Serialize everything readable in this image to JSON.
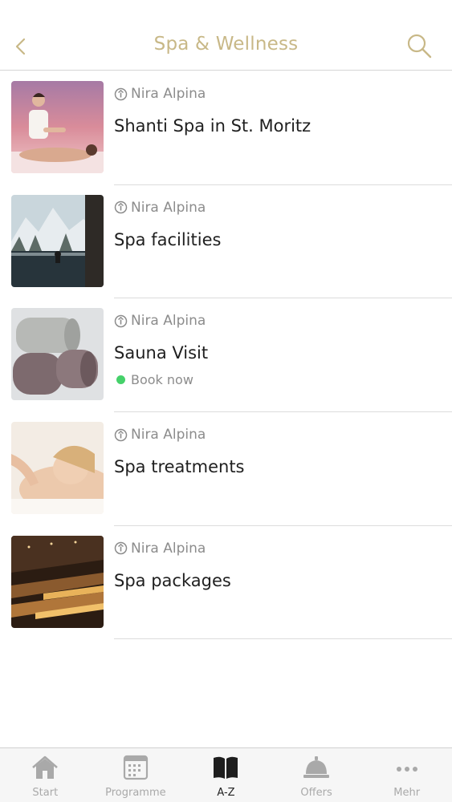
{
  "header": {
    "title": "Spa & Wellness",
    "back_icon": "chevron-left-icon",
    "search_icon": "search-icon",
    "accent_color": "#c8b887"
  },
  "items": [
    {
      "provider": "Nira Alpina",
      "title": "Shanti Spa in St. Moritz"
    },
    {
      "provider": "Nira Alpina",
      "title": "Spa facilities"
    },
    {
      "provider": "Nira Alpina",
      "title": "Sauna Visit",
      "status": "Book now",
      "status_color": "#45d16a"
    },
    {
      "provider": "Nira Alpina",
      "title": "Spa treatments"
    },
    {
      "provider": "Nira Alpina",
      "title": "Spa packages"
    }
  ],
  "tabbar": {
    "tabs": [
      {
        "label": "Start",
        "icon": "house-icon"
      },
      {
        "label": "Programme",
        "icon": "calendar-icon"
      },
      {
        "label": "A-Z",
        "icon": "book-icon",
        "active": true
      },
      {
        "label": "Offers",
        "icon": "bell-icon"
      },
      {
        "label": "Mehr",
        "icon": "more-icon"
      }
    ]
  }
}
